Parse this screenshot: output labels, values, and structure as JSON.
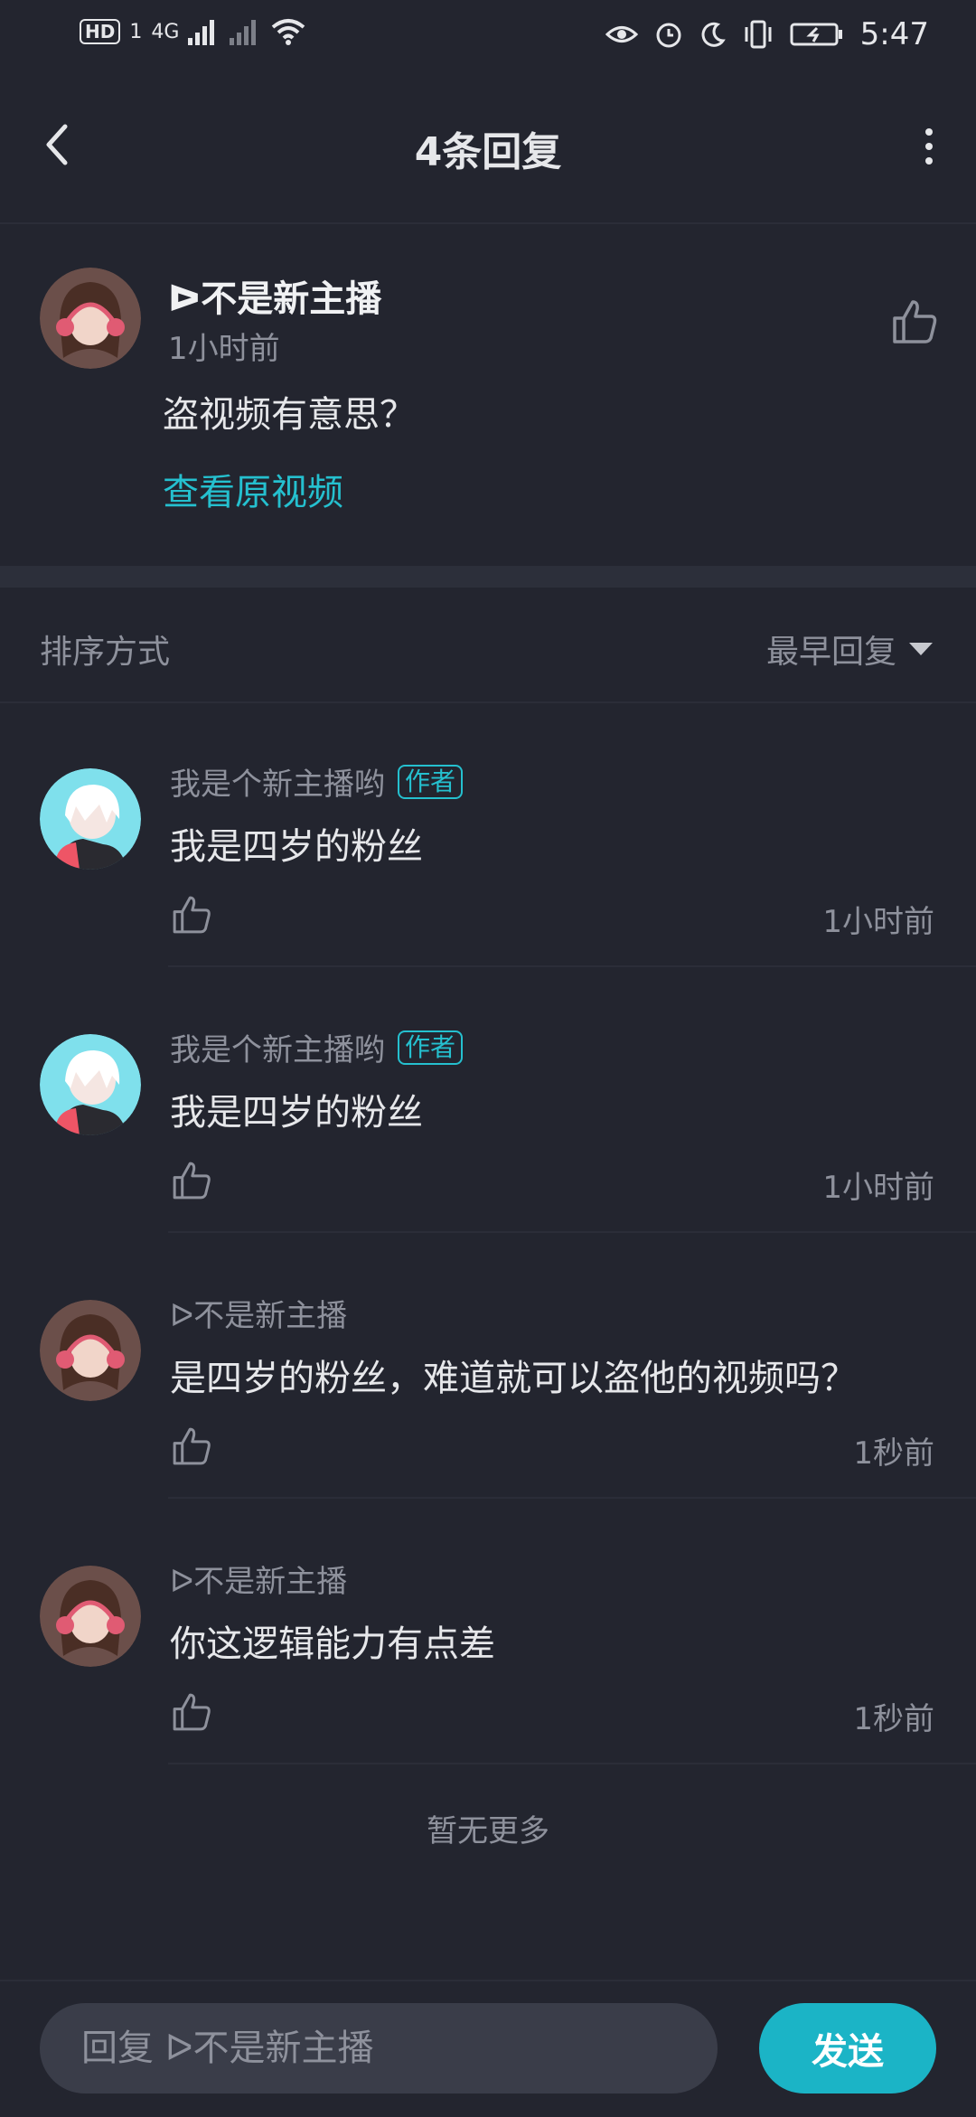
{
  "status_bar": {
    "hd": "HD",
    "sim": "1",
    "network": "4G",
    "time": "5:47",
    "icons": [
      "eye-icon",
      "alarm-icon",
      "moon-icon",
      "vibrate-icon",
      "battery-charging-icon"
    ]
  },
  "header": {
    "title": "4条回复"
  },
  "root_comment": {
    "username": "ᐅ不是新主播",
    "time": "1小时前",
    "text": "盗视频有意思？",
    "view_original": "查看原视频"
  },
  "sort": {
    "label": "排序方式",
    "selected": "最早回复"
  },
  "replies": [
    {
      "username": "我是个新主播哟",
      "badge": "作者",
      "text": "我是四岁的粉丝",
      "time": "1小时前",
      "avatar": "white-hair-avatar"
    },
    {
      "username": "我是个新主播哟",
      "badge": "作者",
      "text": "我是四岁的粉丝",
      "time": "1小时前",
      "avatar": "white-hair-avatar"
    },
    {
      "username": "ᐅ不是新主播",
      "badge": "",
      "text": "是四岁的粉丝，难道就可以盗他的视频吗？",
      "time": "1秒前",
      "avatar": "headphone-girl-avatar"
    },
    {
      "username": "ᐅ不是新主播",
      "badge": "",
      "text": "你这逻辑能力有点差",
      "time": "1秒前",
      "avatar": "headphone-girl-avatar"
    }
  ],
  "footer_text": "暂无更多",
  "input": {
    "placeholder": "回复 ᐅ不是新主播",
    "send_label": "发送"
  },
  "colors": {
    "background": "#23252f",
    "accent": "#25c0cf",
    "send_button": "#1bb4c6",
    "secondary_text": "#8e919c"
  }
}
